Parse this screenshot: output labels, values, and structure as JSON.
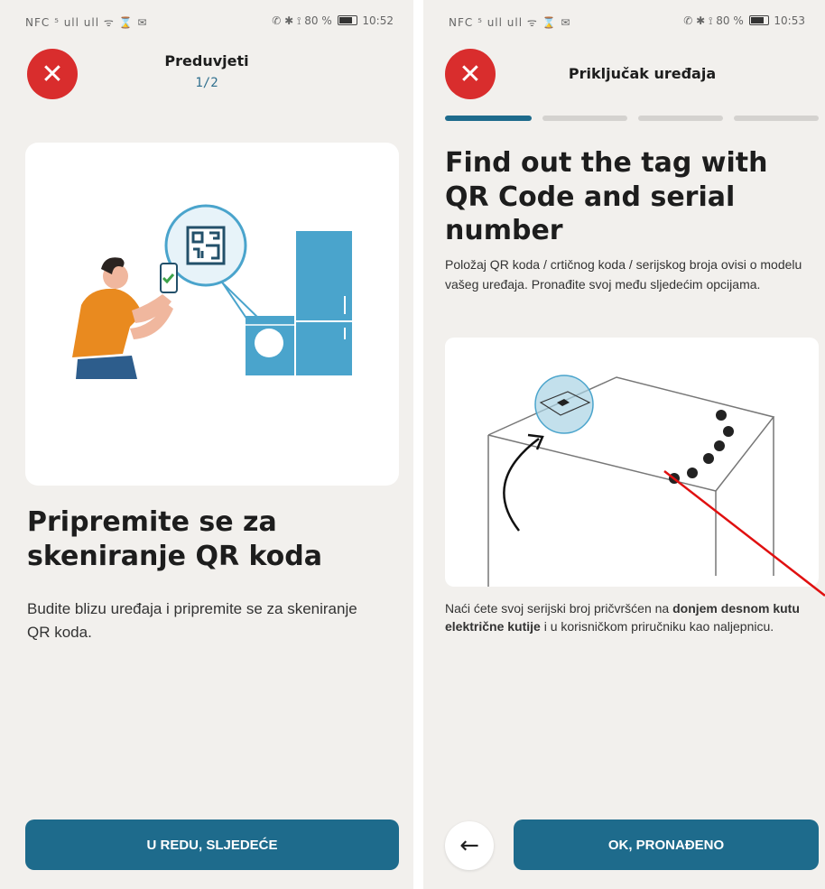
{
  "left_screen": {
    "status_bar": {
      "left_icons": "NFC ⁵ ull ull ᯤ ⌛ ✉",
      "right_prefix": "✆ ✱ ⟟ 80 %",
      "time": "10:52"
    },
    "title": "Preduvjeti",
    "step": "1/2",
    "heading": "Pripremite se za skeniranje QR koda",
    "description": "Budite blizu uređaja i pripremite se za skeniranje QR koda.",
    "button_label": "U REDU, SLJEDEĆE"
  },
  "right_screen": {
    "status_bar": {
      "left_icons": "NFC ⁵ ull ull ᯤ ⌛ ✉",
      "right_prefix": "✆ ✱ ⟟ 80 %",
      "time": "10:53"
    },
    "title": "Priključak uređaja",
    "progress_steps": 4,
    "progress_active": 1,
    "heading": "Find out the tag with QR Code and serial number",
    "description": "Položaj QR koda / crtičnog koda / serijskog broja ovisi o modelu vašeg uređaja. Pronađite svoj među sljedećim opcijama.",
    "note_part1": "Naći ćete svoj serijski broj pričvršćen na ",
    "note_bold": "donjem desnom kutu električne kutije",
    "note_part2": " i u korisničkom priručniku kao naljepnicu.",
    "button_label": "OK, PRONAĐENO"
  },
  "colors": {
    "primary": "#1e6b8c",
    "close": "#d92d2d",
    "background": "#f2f0ed",
    "annotation": "#e01010"
  },
  "icons": {
    "close": "close-icon",
    "back": "arrow-left-icon"
  }
}
